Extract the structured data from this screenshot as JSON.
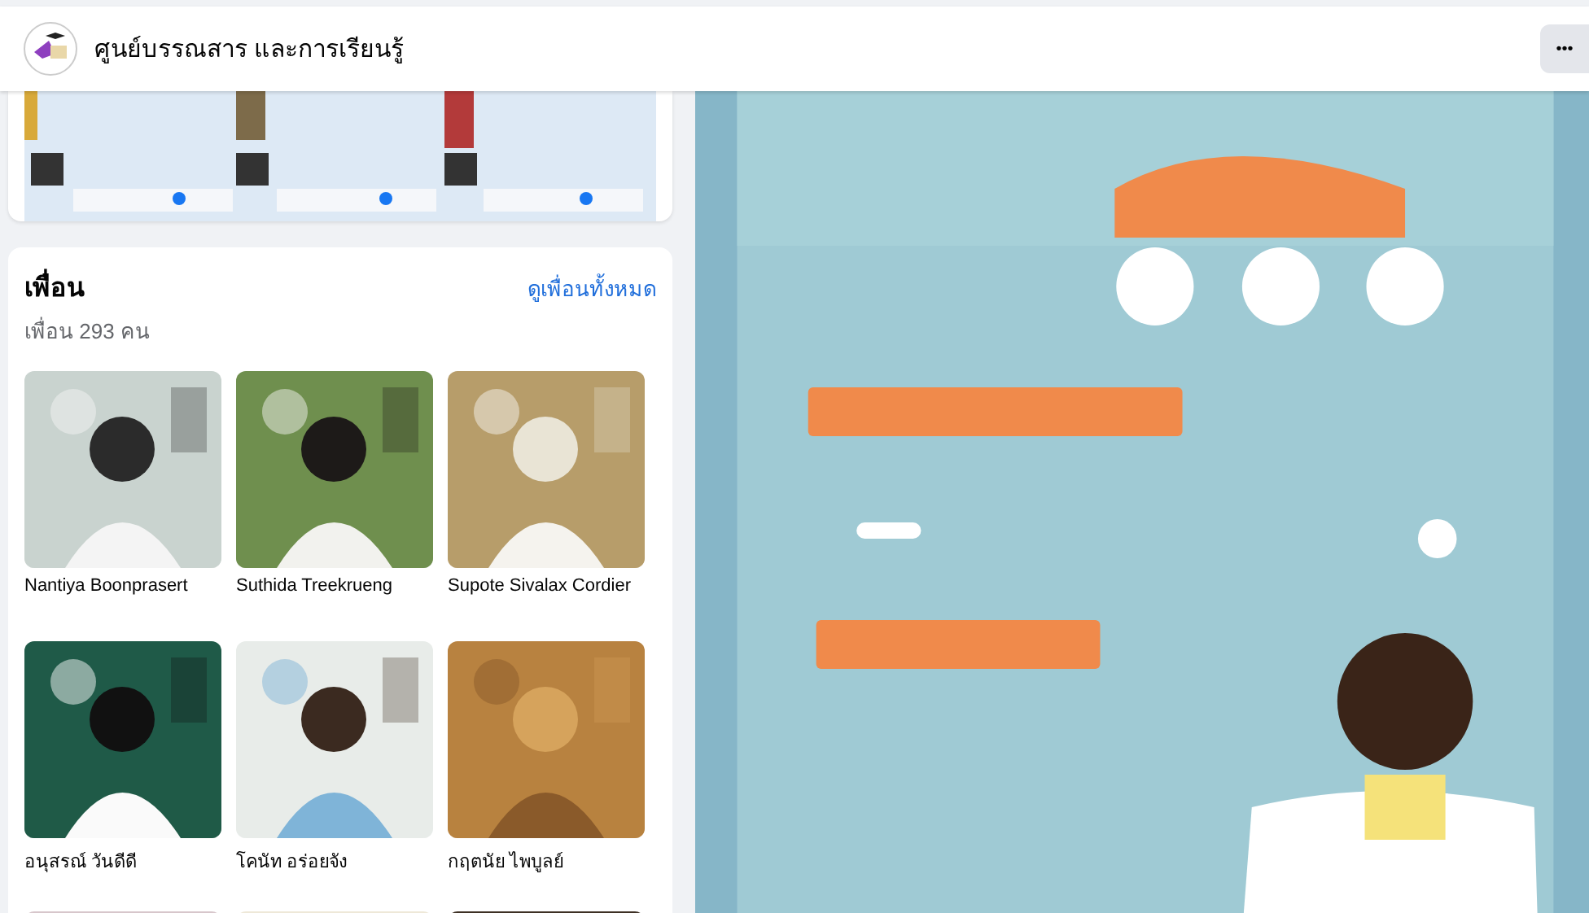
{
  "header": {
    "page_name": "ศูนย์บรรณสาร และการเรียนรู้",
    "more_button": "•••"
  },
  "top_post": {
    "kind": "picture"
  },
  "friends": {
    "title": "เพื่อน",
    "count": "เพื่อน 293 คน",
    "see_all": "ดูเพื่อนทั้งหมด",
    "items": [
      {
        "kind": "picture",
        "name": "Nantiya Boonprasert"
      },
      {
        "kind": "picture",
        "name": "Suthida Treekrueng"
      },
      {
        "kind": "picture",
        "name": "Supote Sivalax Cordier"
      },
      {
        "kind": "picture",
        "name": "อนุสรณ์ วันดีดี"
      },
      {
        "kind": "picture",
        "name": "โคนัท อร่อยจัง"
      },
      {
        "kind": "picture",
        "name": "กฤตนัย ไพบูลย์"
      },
      {
        "kind": "picture"
      },
      {
        "kind": "picture"
      },
      {
        "kind": "picture"
      }
    ]
  },
  "post_image": {
    "kind": "picture"
  }
}
